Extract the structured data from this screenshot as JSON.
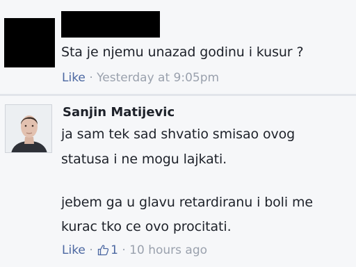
{
  "comments": [
    {
      "author_redacted": true,
      "text_lines": [
        "Sta je njemu unazad godinu i kusur ?"
      ],
      "like_label": "Like",
      "separator": "·",
      "timestamp": "Yesterday at 9:05pm"
    },
    {
      "author": "Sanjin Matijevic",
      "text_lines": [
        "ja sam tek sad shvatio smisao ovog",
        "statusa i ne mogu lajkati.",
        "",
        "jebem ga u glavu retardiranu i boli me",
        "kurac tko ce ovo procitati."
      ],
      "like_label": "Like",
      "separator": "·",
      "like_count": "1",
      "timestamp": "10 hours ago"
    }
  ],
  "colors": {
    "link": "#4b67a1",
    "meta": "#9aa1ad",
    "background": "#f6f7f9"
  }
}
